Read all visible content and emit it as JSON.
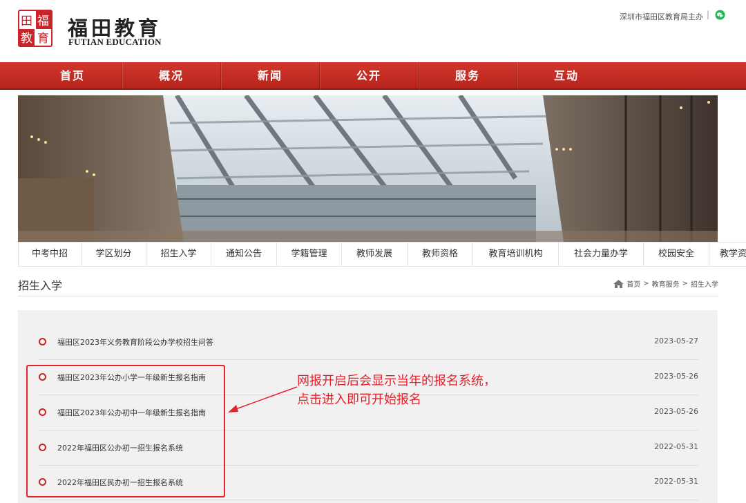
{
  "header": {
    "logo_seal_chars": "福田教育",
    "logo_cn": "福田教育",
    "logo_en": "FUTIAN EDUCATION",
    "sponsor": "深圳市福田区教育局主办"
  },
  "nav": [
    "首页",
    "概况",
    "新闻",
    "公开",
    "服务",
    "互动"
  ],
  "subnav": [
    "中考中招",
    "学区划分",
    "招生入学",
    "通知公告",
    "学籍管理",
    "教师发展",
    "教师资格",
    "教育培训机构",
    "社会力量办学",
    "校园安全",
    "教学资源"
  ],
  "section": {
    "title": "招生入学",
    "breadcrumb": [
      "首页",
      "教育服务",
      "招生入学"
    ],
    "breadcrumb_sep": ">"
  },
  "list": [
    {
      "title": "福田区2023年义务教育阶段公办学校招生问答",
      "date": "2023-05-27"
    },
    {
      "title": "福田区2023年公办小学一年级新生报名指南",
      "date": "2023-05-26"
    },
    {
      "title": "福田区2023年公办初中一年级新生报名指南",
      "date": "2023-05-26"
    },
    {
      "title": "2022年福田区公办初一招生报名系统",
      "date": "2022-05-31"
    },
    {
      "title": "2022年福田区民办初一招生报名系统",
      "date": "2022-05-31"
    }
  ],
  "annotation": {
    "line1": "网报开启后会显示当年的报名系统，",
    "line2": "点击进入即可开始报名"
  },
  "colors": {
    "brand_red": "#c8242a",
    "annotation_red": "#e8202a",
    "list_bg": "#f1f1f1"
  }
}
